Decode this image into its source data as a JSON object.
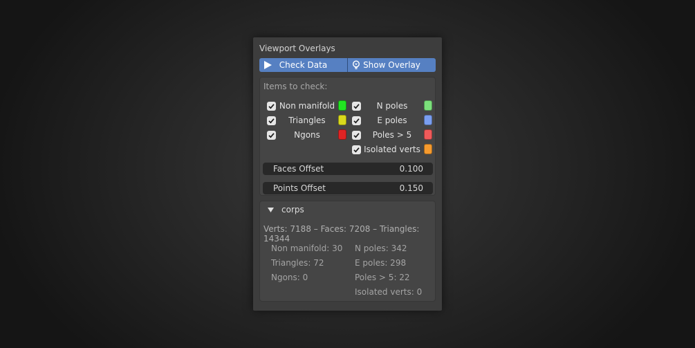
{
  "panel": {
    "title": "Viewport Overlays"
  },
  "buttons": {
    "check_data": "Check Data",
    "show_overlay": "Show Overlay"
  },
  "items": {
    "header": "Items to check:",
    "left": [
      {
        "label": "Non manifold",
        "checked": true,
        "color": "#22e622"
      },
      {
        "label": "Triangles",
        "checked": true,
        "color": "#d9d91c"
      },
      {
        "label": "Ngons",
        "checked": true,
        "color": "#e02424"
      }
    ],
    "right": [
      {
        "label": "N poles",
        "checked": true,
        "color": "#7be07b"
      },
      {
        "label": "E poles",
        "checked": true,
        "color": "#7a9ef0"
      },
      {
        "label": "Poles > 5",
        "checked": true,
        "color": "#f05a5a"
      },
      {
        "label": "Isolated verts",
        "checked": true,
        "color": "#f59a2e"
      }
    ]
  },
  "faces_offset": {
    "label": "Faces Offset",
    "value": "0.100"
  },
  "points_offset": {
    "label": "Points Offset",
    "value": "0.150"
  },
  "object": {
    "name": "corps",
    "summary": "Verts: 7188 – Faces: 7208 – Triangles: 14344",
    "left_stats": [
      "Non manifold: 30",
      "Triangles: 72",
      "Ngons: 0"
    ],
    "right_stats": [
      "N poles: 342",
      "E poles: 298",
      "Poles > 5: 22",
      "Isolated verts: 0"
    ]
  },
  "icons": {
    "play": "play-icon",
    "bulb": "lightbulb-icon",
    "expand": "triangle-down-icon",
    "check": "checkmark-icon"
  }
}
